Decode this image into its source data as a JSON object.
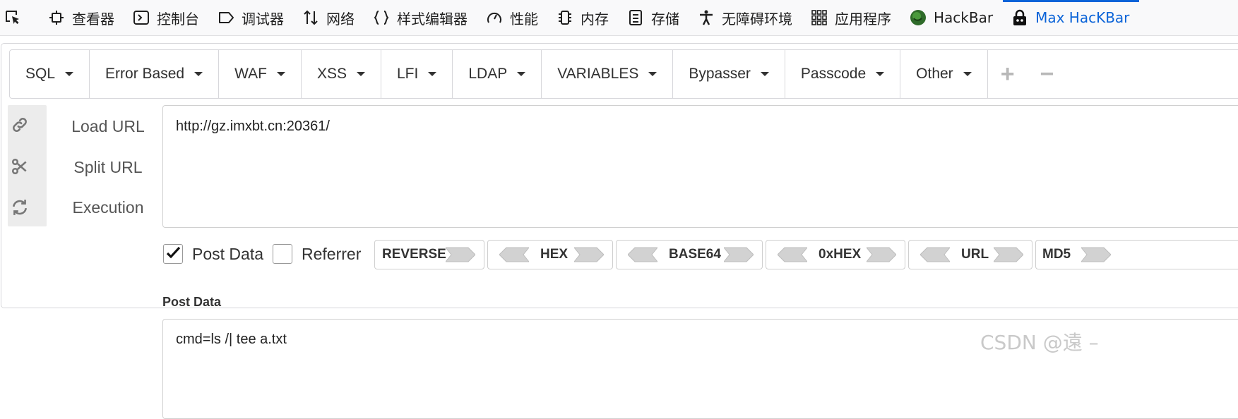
{
  "devtools": {
    "tabs": [
      {
        "label": "",
        "icon": "element-picker-icon"
      },
      {
        "label": "查看器",
        "icon": "inspector-icon"
      },
      {
        "label": "控制台",
        "icon": "console-icon"
      },
      {
        "label": "调试器",
        "icon": "debugger-icon"
      },
      {
        "label": "网络",
        "icon": "network-icon"
      },
      {
        "label": "样式编辑器",
        "icon": "style-editor-icon"
      },
      {
        "label": "性能",
        "icon": "performance-icon"
      },
      {
        "label": "内存",
        "icon": "memory-icon"
      },
      {
        "label": "存储",
        "icon": "storage-icon"
      },
      {
        "label": "无障碍环境",
        "icon": "accessibility-icon"
      },
      {
        "label": "应用程序",
        "icon": "application-icon"
      },
      {
        "label": "HackBar",
        "icon": "hackbar-icon"
      },
      {
        "label": "Max HacKBar",
        "icon": "max-hackbar-icon",
        "active": true
      }
    ],
    "active_color": "#0a63d8"
  },
  "hackbar": {
    "menus": [
      "SQL",
      "Error Based",
      "WAF",
      "XSS",
      "LFI",
      "LDAP",
      "VARIABLES",
      "Bypasser",
      "Passcode",
      "Other"
    ],
    "add_label": "+",
    "remove_label": "−",
    "actions": [
      {
        "label": "Load URL",
        "icon": "link-icon"
      },
      {
        "label": "Split URL",
        "icon": "scissors-icon"
      },
      {
        "label": "Execution",
        "icon": "refresh-icon"
      }
    ],
    "url_value": "http://gz.imxbt.cn:20361/",
    "post_data_checkbox": {
      "label": "Post Data",
      "checked": true
    },
    "referrer_checkbox": {
      "label": "Referrer",
      "checked": false
    },
    "encoders": [
      "REVERSE",
      "HEX",
      "BASE64",
      "0xHEX",
      "URL",
      "MD5"
    ],
    "post_data_label": "Post Data",
    "post_data_value": "cmd=ls /| tee a.txt"
  },
  "watermark": "CSDN @遠 –"
}
